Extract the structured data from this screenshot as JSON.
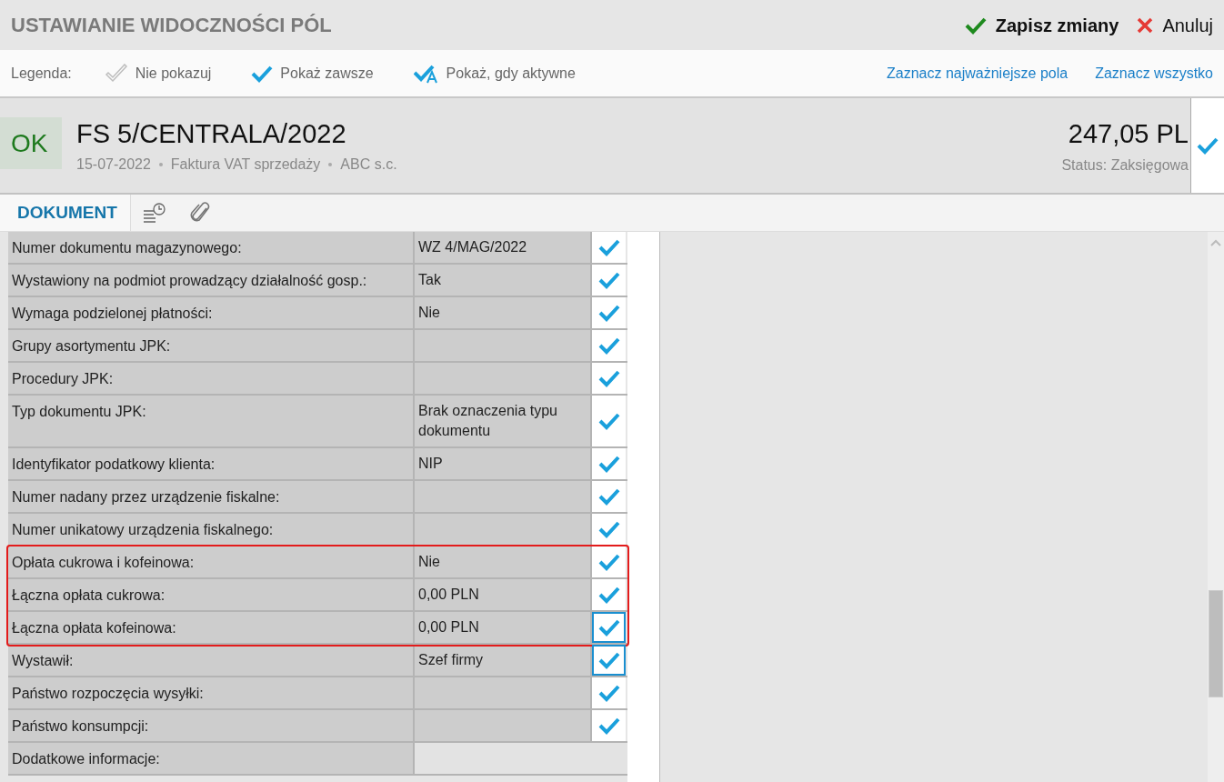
{
  "title": "USTAWIANIE WIDOCZNOŚCI PÓL",
  "actions": [
    {
      "kind": "save",
      "label": "Zapisz zmiany"
    },
    {
      "kind": "cancel",
      "label": "Anuluj"
    }
  ],
  "legend": {
    "label": "Legenda:",
    "items": [
      {
        "kind": "never",
        "label": "Nie pokazuj"
      },
      {
        "kind": "always",
        "label": "Pokaż zawsze"
      },
      {
        "kind": "active",
        "label": "Pokaż, gdy aktywne"
      }
    ],
    "links": [
      "Zaznacz najważniejsze pola",
      "Zaznacz wszystko"
    ]
  },
  "document": {
    "badge": "OK",
    "number": "FS 5/CENTRALA/2022",
    "meta": [
      "15-07-2022",
      "Faktura VAT sprzedaży",
      "ABC s.c."
    ],
    "amount": "247,05 PL",
    "status": "Status: Zaksięgowa",
    "checked": true
  },
  "tabs": [
    {
      "kind": "text",
      "label": "DOKUMENT",
      "selected": true
    },
    {
      "kind": "history",
      "selected": false
    },
    {
      "kind": "attachments",
      "selected": false
    }
  ],
  "sections": [
    {
      "highlighted": false,
      "rows": [
        {
          "label": "Numer dokumentu magazynowego:",
          "value": "WZ 4/MAG/2022",
          "checked": true,
          "focused": false
        },
        {
          "label": "Wystawiony na podmiot prowadzący działalność gosp.:",
          "value": "Tak",
          "checked": true,
          "focused": false
        },
        {
          "label": "Wymaga podzielonej płatności:",
          "value": "Nie",
          "checked": true,
          "focused": false
        },
        {
          "label": "Grupy asortymentu JPK:",
          "checked": true,
          "focused": false
        },
        {
          "label": "Procedury JPK:",
          "checked": true,
          "focused": false
        },
        {
          "label": "Typ dokumentu JPK:",
          "value": "Brak oznaczenia typu dokumentu",
          "checked": true,
          "focused": false
        },
        {
          "label": "Identyfikator podatkowy klienta:",
          "value": "NIP",
          "checked": true,
          "focused": false
        },
        {
          "label": "Numer nadany przez urządzenie fiskalne:",
          "checked": true,
          "focused": false
        },
        {
          "label": "Numer unikatowy urządzenia fiskalnego:",
          "checked": true,
          "focused": false
        }
      ]
    },
    {
      "highlighted": true,
      "rows": [
        {
          "label": "Opłata cukrowa i kofeinowa:",
          "value": "Nie",
          "checked": true,
          "focused": false
        },
        {
          "label": "Łączna opłata cukrowa:",
          "value": "0,00 PLN",
          "checked": true,
          "focused": false
        },
        {
          "label": "Łączna opłata kofeinowa:",
          "value": "0,00 PLN",
          "checked": true,
          "focused": true
        }
      ]
    },
    {
      "highlighted": false,
      "rows": [
        {
          "label": "Wystawił:",
          "value": "Szef firmy",
          "checked": true,
          "focused": true
        },
        {
          "label": "Państwo rozpoczęcia wysyłki:",
          "checked": true,
          "focused": false
        },
        {
          "label": "Państwo konsumpcji:",
          "checked": true,
          "focused": false
        },
        {
          "label": "Dodatkowe informacje:"
        }
      ]
    }
  ]
}
